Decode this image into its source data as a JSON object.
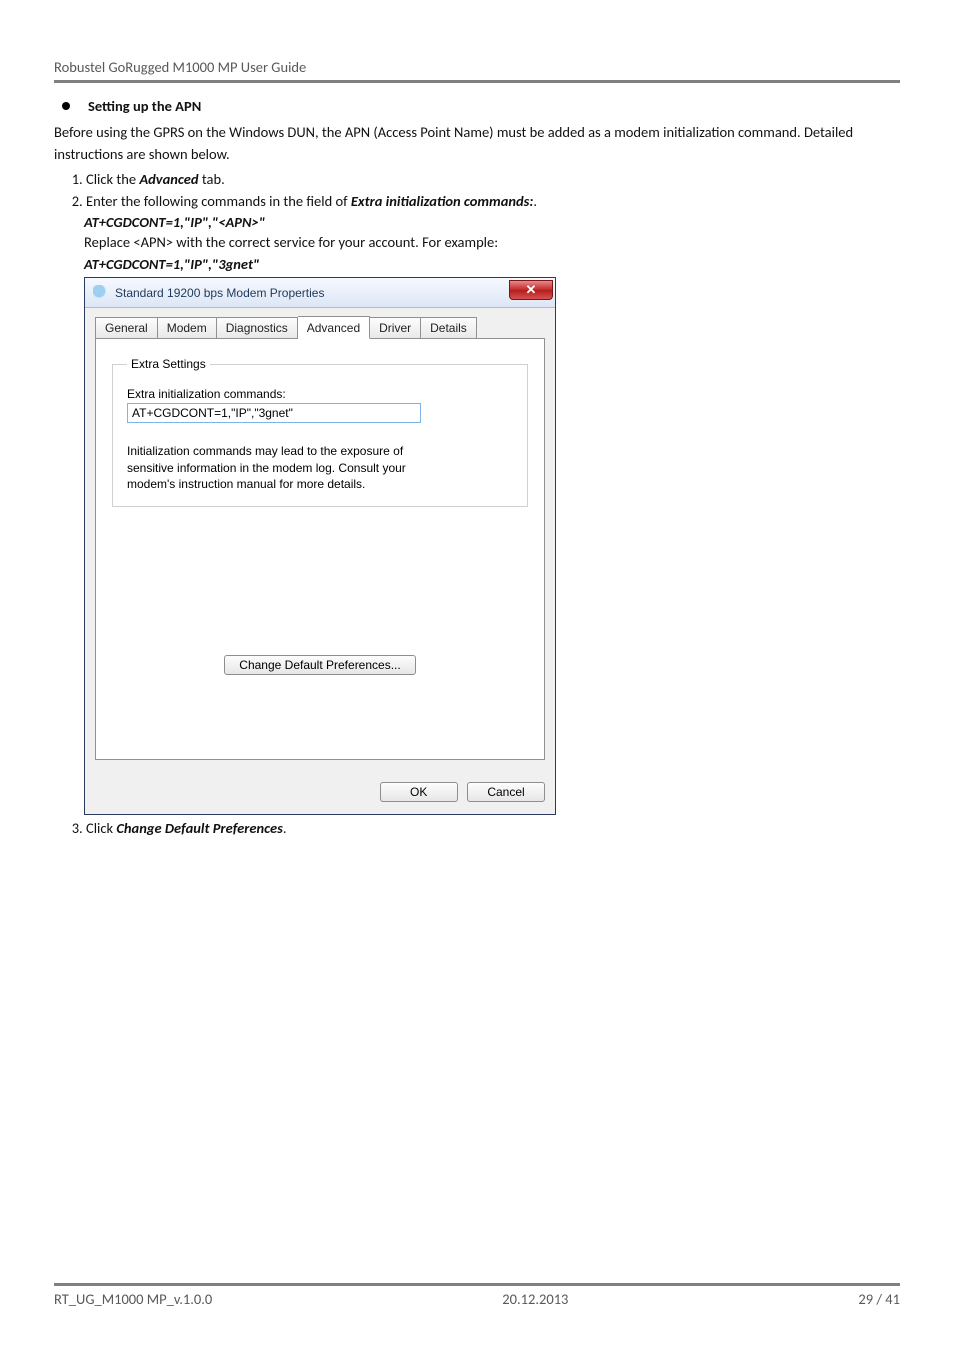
{
  "docHeader": "Robustel GoRugged M1000 MP User Guide",
  "section": {
    "title": "Setting up the APN",
    "intro": "Before using the GPRS on the Windows DUN, the APN (Access Point Name) must be added as a modem initialization command. Detailed instructions are shown below.",
    "step1_pre": "Click the ",
    "step1_bold": "Advanced",
    "step1_post": " tab.",
    "step2_pre": "Enter the following commands in the field of ",
    "step2_bold": "Extra initialization commands:",
    "step2_post": ".",
    "cmd1": "AT+CGDCONT=1,\"IP\",\"<APN>\"",
    "replace": "Replace <APN> with the correct service for your account. For example:",
    "cmd2": "AT+CGDCONT=1,\"IP\",\"3gnet\"",
    "step3_pre": "Click ",
    "step3_bold": "Change Default Preferences",
    "step3_post": "."
  },
  "dialog": {
    "title": "Standard 19200 bps Modem Properties",
    "closeGlyph": "✕",
    "tabs": {
      "general": "General",
      "modem": "Modem",
      "diagnostics": "Diagnostics",
      "advanced": "Advanced",
      "driver": "Driver",
      "details": "Details"
    },
    "extraLegend": "Extra Settings",
    "extraLabel": "Extra initialization commands:",
    "extraValue": "AT+CGDCONT=1,\"IP\",\"3gnet\"",
    "note": "Initialization commands may lead to the exposure of sensitive information in the modem log. Consult your modem's instruction manual for more details.",
    "changeBtn": "Change Default Preferences...",
    "ok": "OK",
    "cancel": "Cancel"
  },
  "footer": {
    "left": "RT_UG_M1000 MP_v.1.0.0",
    "center": "20.12.2013",
    "right": "29 / 41"
  }
}
